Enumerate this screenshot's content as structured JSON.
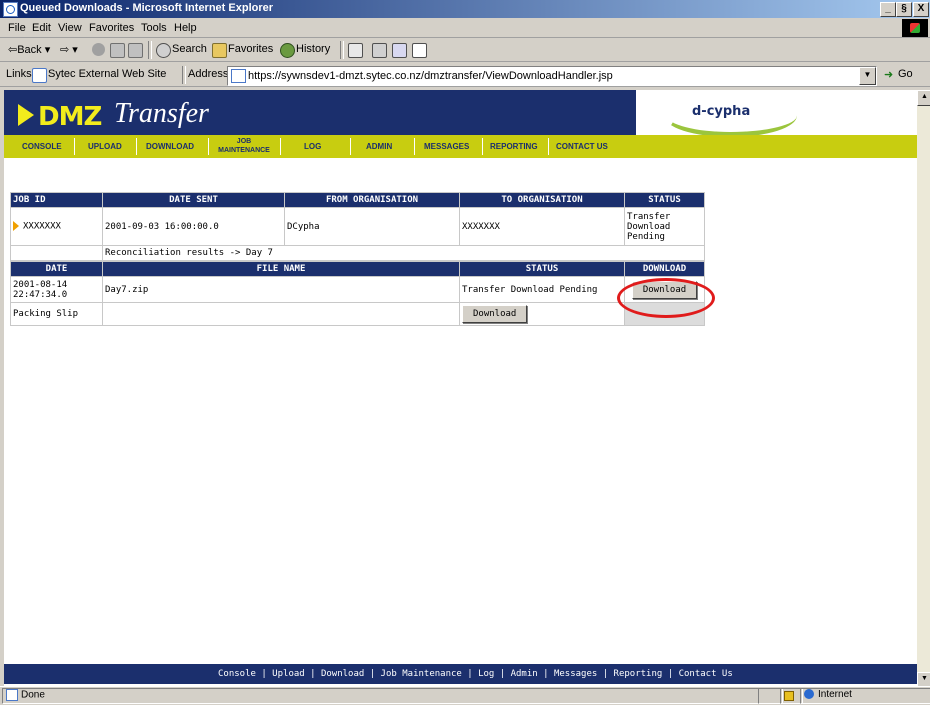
{
  "window": {
    "title": "Queued Downloads - Microsoft Internet Explorer",
    "min_label": "_",
    "max_label": "§",
    "close_label": "X"
  },
  "menu": [
    "File",
    "Edit",
    "View",
    "Favorites",
    "Tools",
    "Help"
  ],
  "toolbar": {
    "back_label": "⇦Back ▾",
    "forward_label": "⇨ ▾",
    "search_label": "Search",
    "favorites_label": "Favorites",
    "history_label": "History"
  },
  "addressbar": {
    "links_label": "Links",
    "link_item": "Sytec External Web Site",
    "address_label": "Address",
    "url": "https://sywnsdev1-dmzt.sytec.co.nz/dmztransfer/ViewDownloadHandler.jsp",
    "go_label": "Go"
  },
  "banner": {
    "logo_dmz": "DMZ",
    "logo_transfer": "Transfer",
    "brand": "d-cypha"
  },
  "nav": {
    "console": "CONSOLE",
    "upload": "UPLOAD",
    "download": "DOWNLOAD",
    "job_top": "JOB",
    "job_bottom": "MAINTENANCE",
    "log": "LOG",
    "admin": "ADMIN",
    "messages": "MESSAGES",
    "reporting": "REPORTING",
    "contact": "CONTACT US"
  },
  "job_table": {
    "headers": {
      "job_id": "JOB ID",
      "date_sent": "DATE SENT",
      "from_org": "FROM ORGANISATION",
      "to_org": "TO ORGANISATION",
      "status": "STATUS"
    },
    "row": {
      "job_id": "XXXXXXX",
      "date_sent": "2001-09-03 16:00:00.0",
      "from_org": "DCypha",
      "to_org": "XXXXXXX",
      "status": "Transfer Download Pending"
    },
    "reconciliation": "Reconciliation results -> Day 7"
  },
  "files_table": {
    "headers": {
      "date": "DATE",
      "file_name": "FILE NAME",
      "status": "STATUS",
      "download": "DOWNLOAD"
    },
    "rows": [
      {
        "date": "2001-08-14 22:47:34.0",
        "file_name": "Day7.zip",
        "status": "Transfer Download Pending",
        "button": "Download"
      }
    ],
    "packing_slip": {
      "label": "Packing Slip",
      "button": "Download"
    }
  },
  "footer_links": "Console | Upload | Download | Job Maintenance | Log | Admin | Messages | Reporting | Contact Us",
  "statusbar": {
    "status": "Done",
    "zone": "Internet"
  },
  "colors": {
    "banner_navy": "#1b2f6d",
    "nav_olive": "#c8cd10",
    "logo_yellow": "#f2ec1c",
    "highlight_red": "#e01b1b"
  }
}
